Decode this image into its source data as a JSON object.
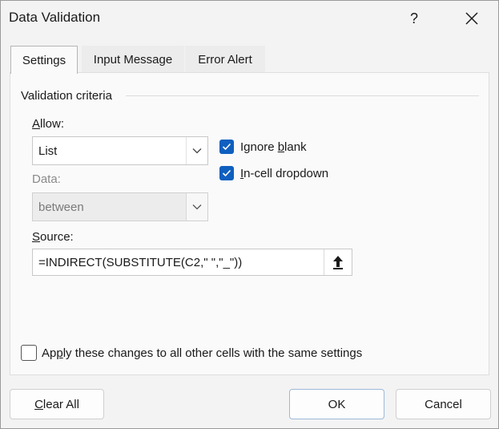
{
  "window": {
    "title": "Data Validation",
    "help": "?"
  },
  "tabs": [
    {
      "label": "Settings",
      "active": true
    },
    {
      "label": "Input Message",
      "active": false
    },
    {
      "label": "Error Alert",
      "active": false
    }
  ],
  "criteria": {
    "group_label": "Validation criteria",
    "allow": {
      "label_key": "A",
      "label_rest": "llow:",
      "value": "List"
    },
    "data": {
      "label": "Data:",
      "value": "between"
    },
    "ignore_blank": {
      "pre": "Ignore ",
      "key": "b",
      "post": "lank",
      "checked": true
    },
    "in_cell_dropdown": {
      "pre": "",
      "key": "I",
      "post": "n-cell dropdown",
      "checked": true
    },
    "source": {
      "label_key": "S",
      "label_rest": "ource:",
      "value": "=INDIRECT(SUBSTITUTE(C2,\" \",\"_\"))"
    }
  },
  "apply_all": {
    "pre": "Ap",
    "key": "p",
    "post": "ly these changes to all other cells with the same settings",
    "checked": false
  },
  "buttons": {
    "clear_key": "C",
    "clear_rest": "lear All",
    "ok": "OK",
    "cancel": "Cancel"
  },
  "colors": {
    "accent": "#0f5fbf"
  },
  "icons": {
    "close": "close-icon",
    "dropdown": "chevron-down-icon",
    "collapse": "arrow-up-icon",
    "check": "checkmark-icon"
  }
}
